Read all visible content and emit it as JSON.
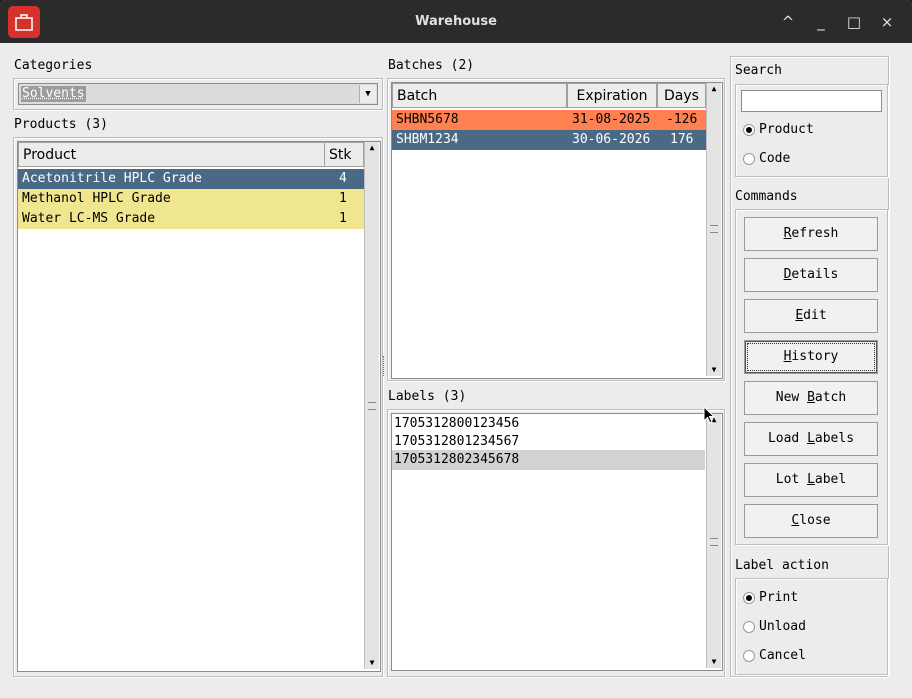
{
  "window": {
    "title": "Warehouse",
    "buttons": [
      "^",
      "_",
      "□",
      "×"
    ]
  },
  "categories": {
    "label": "Categories",
    "selected": "Solvents"
  },
  "products": {
    "label": "Products (3)",
    "columns": [
      "Product",
      "Stk"
    ],
    "rows": [
      {
        "name": "Acetonitrile HPLC Grade",
        "stk": "4",
        "state": "selected"
      },
      {
        "name": "Methanol HPLC Grade",
        "stk": "1",
        "state": "low"
      },
      {
        "name": "Water LC-MS Grade",
        "stk": "1",
        "state": "low"
      }
    ]
  },
  "batches": {
    "label": "Batches (2)",
    "columns": [
      "Batch",
      "Expiration",
      "Days"
    ],
    "rows": [
      {
        "batch": "SHBN5678",
        "expiration": "31-08-2025",
        "days": "-126",
        "state": "expired"
      },
      {
        "batch": "SHBM1234",
        "expiration": "30-06-2026",
        "days": "176",
        "state": "selected"
      }
    ]
  },
  "labels": {
    "label": "Labels (3)",
    "items": [
      "1705312800123456",
      "1705312801234567",
      "1705312802345678"
    ],
    "selected_index": 2
  },
  "search": {
    "label": "Search",
    "value": "",
    "options": [
      "Product",
      "Code"
    ],
    "selected": "Product"
  },
  "commands": {
    "label": "Commands",
    "buttons": [
      {
        "label": "Refresh",
        "mnemonic": "R",
        "rest": "efresh"
      },
      {
        "label": "Details",
        "mnemonic": "D",
        "rest": "etails"
      },
      {
        "label": "Edit",
        "mnemonic": "E",
        "rest": "dit"
      },
      {
        "label": "History",
        "mnemonic": "H",
        "rest": "istory"
      },
      {
        "label": "New Batch",
        "pre": "New ",
        "mnemonic": "B",
        "rest": "atch"
      },
      {
        "label": "Load Labels",
        "pre": "Load ",
        "mnemonic": "L",
        "rest": "abels"
      },
      {
        "label": "Lot Label",
        "pre": "Lot ",
        "mnemonic": "L",
        "rest": "abel"
      },
      {
        "label": "Close",
        "mnemonic": "C",
        "rest": "lose"
      }
    ]
  },
  "label_action": {
    "label": "Label action",
    "options": [
      "Print",
      "Unload",
      "Cancel"
    ],
    "selected": "Print"
  },
  "colors": {
    "selected_row": "#4a6985",
    "low_stock": "#efe68f",
    "expired": "#ff8050",
    "titlebar": "#2b2b2b",
    "app_icon": "#d5322e"
  }
}
